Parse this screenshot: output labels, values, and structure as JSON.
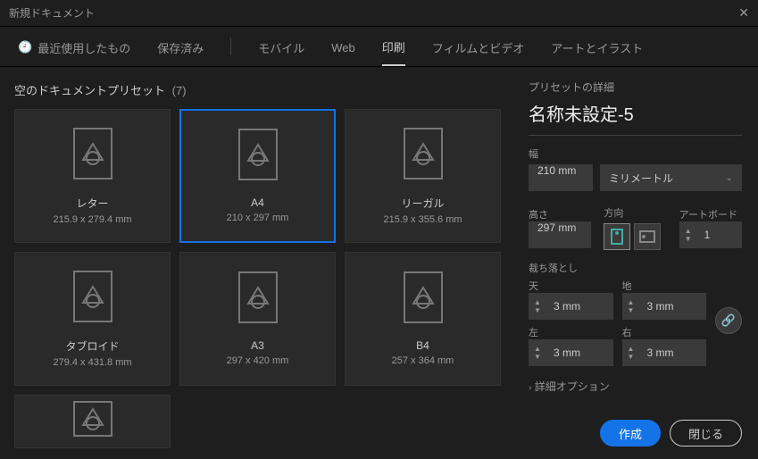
{
  "title": "新規ドキュメント",
  "tabs": {
    "recent": "最近使用したもの",
    "saved": "保存済み",
    "mobile": "モバイル",
    "web": "Web",
    "print": "印刷",
    "film": "フィルムとビデオ",
    "art": "アートとイラスト"
  },
  "active_tab": "print",
  "presets": {
    "heading": "空のドキュメントプリセット",
    "count": "(7)",
    "items": [
      {
        "name": "レター",
        "dim": "215.9 x 279.4 mm"
      },
      {
        "name": "A4",
        "dim": "210 x 297 mm"
      },
      {
        "name": "リーガル",
        "dim": "215.9 x 355.6 mm"
      },
      {
        "name": "タブロイド",
        "dim": "279.4 x 431.8 mm"
      },
      {
        "name": "A3",
        "dim": "297 x 420 mm"
      },
      {
        "name": "B4",
        "dim": "257 x 364 mm"
      }
    ],
    "selected_index": 1
  },
  "details": {
    "heading": "プリセットの詳細",
    "name": "名称未設定-5",
    "width_label": "幅",
    "width": "210 mm",
    "unit_label": "ミリメートル",
    "height_label": "高さ",
    "height": "297 mm",
    "orient_label": "方向",
    "artboard_label": "アートボード",
    "artboards": "1",
    "bleed_label": "裁ち落とし",
    "top_label": "天",
    "bottom_label": "地",
    "left_label": "左",
    "right_label": "右",
    "bleed_top": "3 mm",
    "bleed_bottom": "3 mm",
    "bleed_left": "3 mm",
    "bleed_right": "3 mm",
    "advanced": "詳細オプション"
  },
  "buttons": {
    "create": "作成",
    "close": "閉じる"
  }
}
